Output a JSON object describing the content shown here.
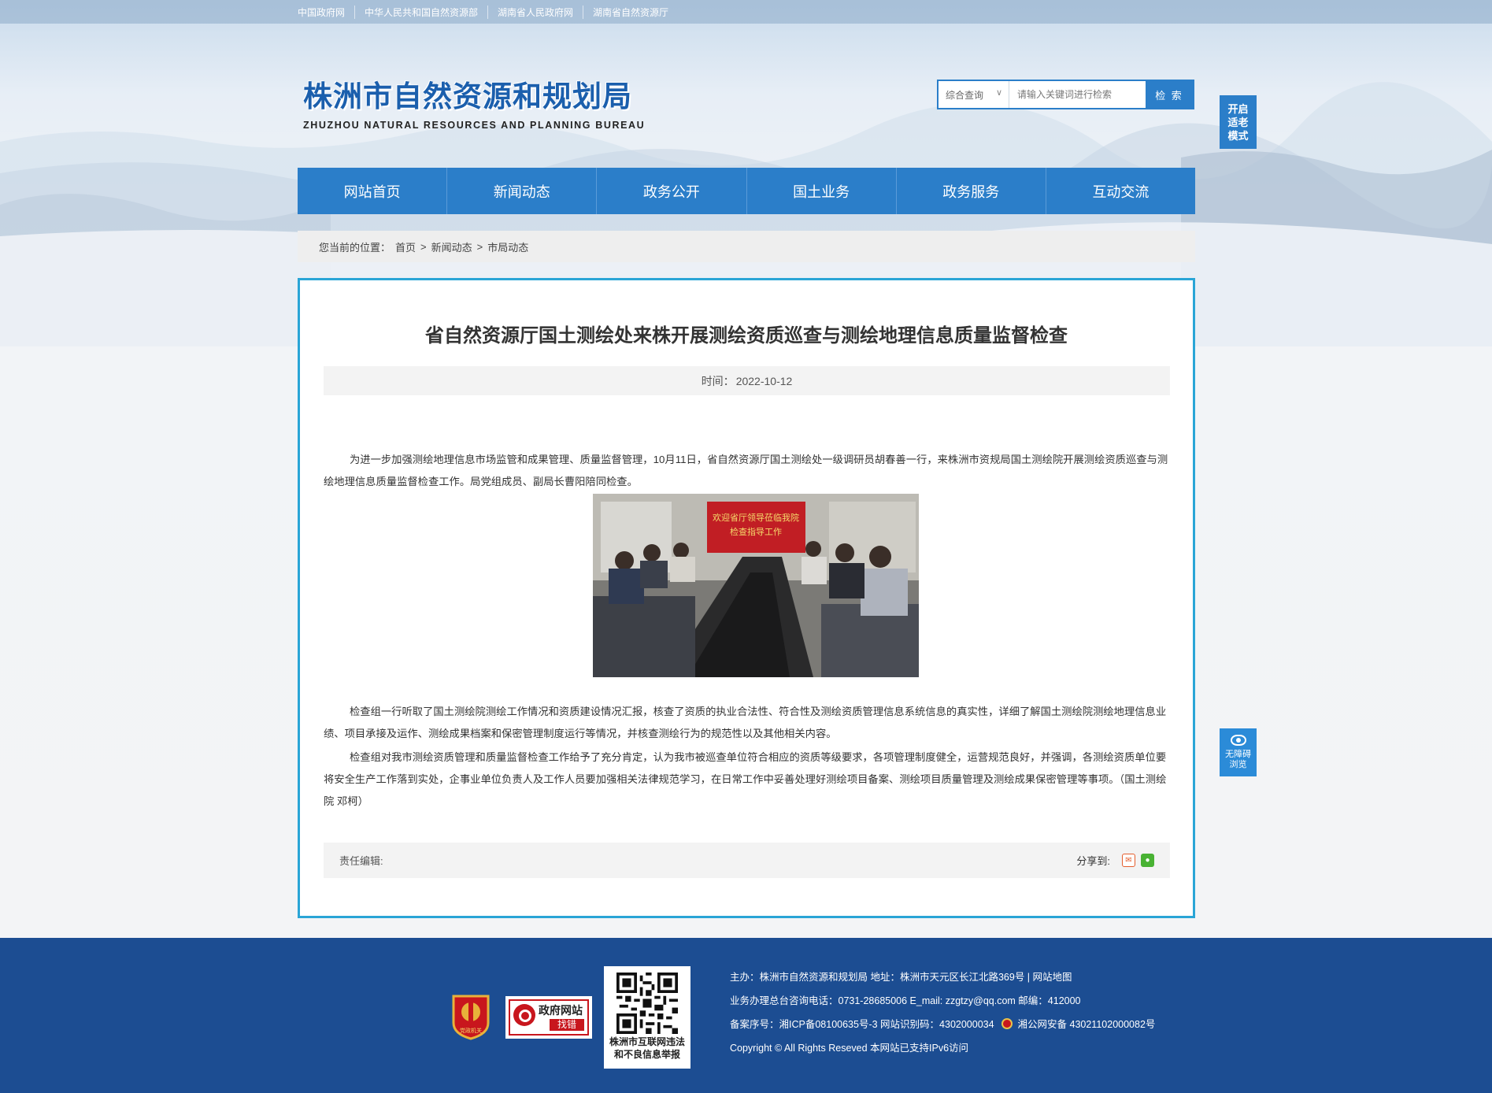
{
  "topbar": {
    "links": [
      "中国政府网",
      "中华人民共和国自然资源部",
      "湖南省人民政府网",
      "湖南省自然资源厅"
    ]
  },
  "header": {
    "logo_cn": "株洲市自然资源和规划局",
    "logo_en": "ZHUZHOU NATURAL RESOURCES AND PLANNING BUREAU",
    "search_select": "综合查询",
    "search_placeholder": "请输入关键词进行检索",
    "search_button": "检 索",
    "elder_mode": [
      "开启",
      "适老",
      "模式"
    ]
  },
  "nav": {
    "items": [
      "网站首页",
      "新闻动态",
      "政务公开",
      "国土业务",
      "政务服务",
      "互动交流"
    ]
  },
  "breadcrumb": {
    "prefix": "您当前的位置：",
    "items": [
      "首页",
      "新闻动态",
      "市局动态"
    ],
    "sep": ">"
  },
  "article": {
    "title": "省自然资源厅国土测绘处来株开展测绘资质巡查与测绘地理信息质量监督检查",
    "time_label": "时间：",
    "time_value": "2022-10-12",
    "paragraphs": [
      "为进一步加强测绘地理信息市场监管和成果管理、质量监督管理，10月11日，省自然资源厅国土测绘处一级调研员胡春善一行，来株洲市资规局国土测绘院开展测绘资质巡查与测绘地理信息质量监督检查工作。局党组成员、副局长曹阳陪同检查。",
      "检查组一行听取了国土测绘院测绘工作情况和资质建设情况汇报，核查了资质的执业合法性、符合性及测绘资质管理信息系统信息的真实性，详细了解国土测绘院测绘地理信息业绩、项目承接及运作、测绘成果档案和保密管理制度运行等情况，并核查测绘行为的规范性以及其他相关内容。",
      "检查组对我市测绘资质管理和质量监督检查工作给予了充分肯定，认为我市被巡查单位符合相应的资质等级要求，各项管理制度健全，运营规范良好，并强调，各测绘资质单位要将安全生产工作落到实处，企事业单位负责人及工作人员要加强相关法律规范学习，在日常工作中妥善处理好测绘项目备案、测绘项目质量管理及测绘成果保密管理等事项。（国土测绘院 邓柯）"
    ],
    "photo_banner": [
      "欢迎省厅领导莅临我院",
      "检查指导工作"
    ],
    "editor_label": "责任编辑:",
    "share_label": "分享到:"
  },
  "accessibility": {
    "label": [
      "无障碍",
      "浏览"
    ]
  },
  "footer": {
    "badge1_text": "党政机关",
    "badge2_title": "政府网站",
    "badge2_sub": "找错",
    "qr_caption": [
      "株洲市互联网违法",
      "和不良信息举报"
    ],
    "rows": [
      "主办：株洲市自然资源和规划局   地址：株洲市天元区长江北路369号  |  网站地图",
      "业务办理总台咨询电话：0731-28685006    E_mail:   zzgtzy@qq.com     邮编：412000",
      "备案序号：湘ICP备08100635号-3  网站识别码：4302000034",
      "Copyright © All Rights Reseved 本网站已支持IPv6访问"
    ],
    "police_text": "湘公网安备 43021102000082号"
  },
  "colors": {
    "primary": "#2b7ec9",
    "article_border": "#2aa5d6",
    "footer_bg": "#1c4d92",
    "logo": "#1b5fad"
  }
}
